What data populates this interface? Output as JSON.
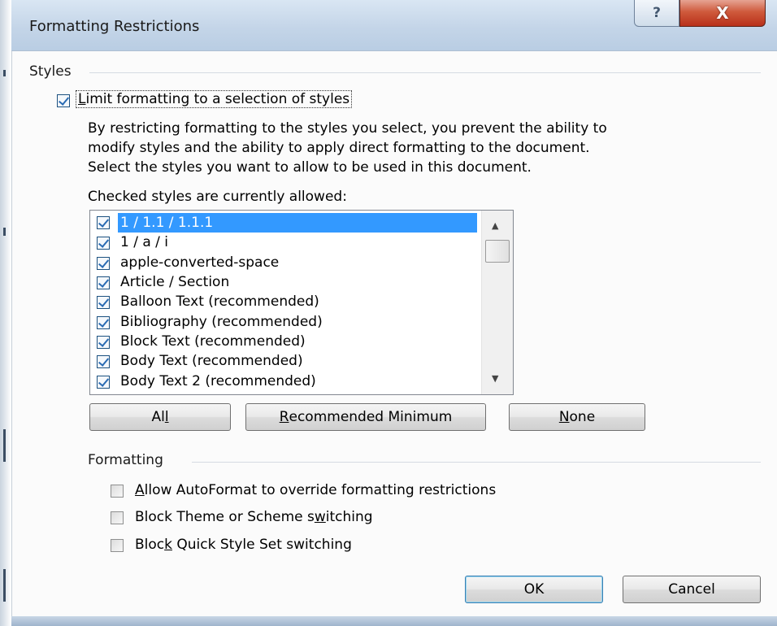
{
  "window": {
    "title": "Formatting Restrictions",
    "help_glyph": "?",
    "close_glyph": "X"
  },
  "styles_section": {
    "label": "Styles",
    "limit_checkbox": {
      "label_prefix": "L",
      "label_rest": "imit formatting to a selection of styles",
      "checked": true
    },
    "description": [
      "By restricting formatting to the styles you select, you prevent the ability to",
      "modify styles and the ability to apply direct formatting to the document.",
      "Select the styles you want to allow to be used in this document."
    ],
    "list_caption": "Checked styles are currently allowed:",
    "items": [
      {
        "label": "1 / 1.1 / 1.1.1",
        "checked": true,
        "selected": true
      },
      {
        "label": "1 / a / i",
        "checked": true,
        "selected": false
      },
      {
        "label": "apple-converted-space",
        "checked": true,
        "selected": false
      },
      {
        "label": "Article / Section",
        "checked": true,
        "selected": false
      },
      {
        "label": "Balloon Text (recommended)",
        "checked": true,
        "selected": false
      },
      {
        "label": "Bibliography (recommended)",
        "checked": true,
        "selected": false
      },
      {
        "label": "Block Text (recommended)",
        "checked": true,
        "selected": false
      },
      {
        "label": "Body Text (recommended)",
        "checked": true,
        "selected": false
      },
      {
        "label": "Body Text 2 (recommended)",
        "checked": true,
        "selected": false
      }
    ],
    "scroll_up_glyph": "▲",
    "scroll_down_glyph": "▼",
    "buttons": {
      "all": {
        "pre": "Al",
        "ul": "l",
        "post": ""
      },
      "recommended": {
        "pre": "",
        "ul": "R",
        "post": "ecommended Minimum"
      },
      "none": {
        "pre": "",
        "ul": "N",
        "post": "one"
      }
    }
  },
  "formatting_section": {
    "label": "Formatting",
    "options": [
      {
        "pre": "",
        "ul": "A",
        "post": "llow AutoFormat to override formatting restrictions",
        "checked": false
      },
      {
        "pre": "Block Theme or Scheme s",
        "ul": "w",
        "post": "itching",
        "checked": false
      },
      {
        "pre": "Bloc",
        "ul": "k",
        "post": " Quick Style Set switching",
        "checked": false
      }
    ]
  },
  "footer": {
    "ok_label": "OK",
    "cancel_label": "Cancel"
  }
}
